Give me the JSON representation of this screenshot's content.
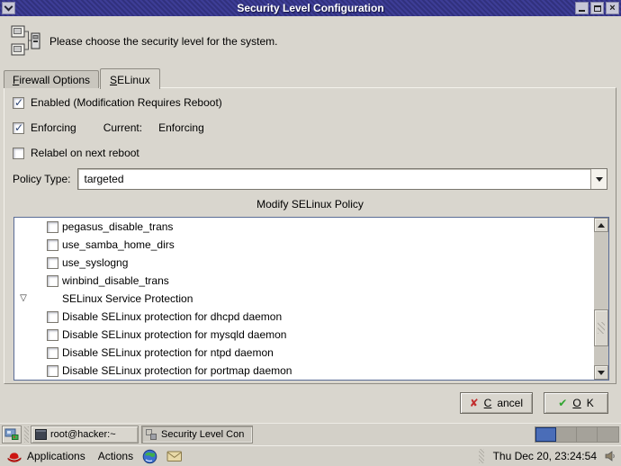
{
  "window": {
    "title": "Security Level Configuration",
    "header": {
      "text": "Please choose the security level for the system."
    },
    "tabs": [
      {
        "label": "Firewall Options",
        "mnemonic_index": 0,
        "active": false
      },
      {
        "label": "SELinux",
        "mnemonic_index": 0,
        "active": true
      }
    ],
    "selinux": {
      "options": [
        {
          "label": "Enabled (Modification Requires Reboot)",
          "checked": true
        },
        {
          "label": "Enforcing",
          "checked": true,
          "current_label": "Current:",
          "current_value": "Enforcing"
        },
        {
          "label": "Relabel on next reboot",
          "checked": false
        }
      ],
      "policy_type": {
        "label": "Policy Type:",
        "value": "targeted"
      },
      "policy_editor": {
        "title": "Modify SELinux Policy",
        "items": [
          {
            "type": "check",
            "label": "pegasus_disable_trans",
            "checked": false
          },
          {
            "type": "check",
            "label": "use_samba_home_dirs",
            "checked": false
          },
          {
            "type": "check",
            "label": "use_syslogng",
            "checked": false
          },
          {
            "type": "check",
            "label": "winbind_disable_trans",
            "checked": false
          },
          {
            "type": "group",
            "label": "SELinux Service Protection",
            "expanded": true
          },
          {
            "type": "check",
            "label": "Disable SELinux protection for dhcpd daemon",
            "checked": false
          },
          {
            "type": "check",
            "label": "Disable SELinux protection for mysqld daemon",
            "checked": false
          },
          {
            "type": "check",
            "label": "Disable SELinux protection for ntpd daemon",
            "checked": false
          },
          {
            "type": "check",
            "label": "Disable SELinux protection for portmap daemon",
            "checked": false
          }
        ]
      }
    },
    "actions": [
      {
        "label": "Cancel",
        "mnemonic_index": 0,
        "icon": "cancel-x-icon",
        "icon_glyph": "✘",
        "icon_color": "#c22f2f"
      },
      {
        "label": "OK",
        "mnemonic_index": 0,
        "icon": "ok-check-icon",
        "icon_glyph": "✔",
        "icon_color": "#2fa52f"
      }
    ]
  },
  "taskbar": {
    "tasks": [
      {
        "label": "root@hacker:~",
        "icon": "terminal-icon",
        "active": false
      },
      {
        "label": "Security Level Con",
        "icon": "security-window-icon",
        "active": true
      }
    ],
    "workspaces": {
      "count": 4,
      "active_index": 0
    }
  },
  "panel": {
    "menus": [
      {
        "label": "Applications",
        "icon": "redhat-menu-icon"
      },
      {
        "label": "Actions"
      }
    ],
    "launchers": [
      "web-browser-icon",
      "email-icon"
    ],
    "clock": "Thu Dec 20, 23:24:54",
    "volume_icon": "speaker-icon"
  },
  "icons": {
    "window-menu": "chevron-down",
    "minimize-icon": "thin dash",
    "maximize-icon": "window outline",
    "close-icon": "x",
    "network-security-icon": "two computers wired to a device",
    "tree-expander-icon": "open down triangle",
    "scroll-up-icon": "up triangle",
    "scroll-down-icon": "down triangle",
    "show-desktop-icon": "mini desktop",
    "redhat-menu-icon": "red fedora hat",
    "web-browser-icon": "blue-green globe",
    "email-icon": "beige envelope",
    "speaker-icon": "speaker"
  },
  "colors": {
    "titlebar_blue_dark": "#31317e",
    "titlebar_blue_light": "#3d3d96",
    "dialog_bg": "#d9d6ce",
    "list_focus_border": "#5a6c96",
    "workspace_active": "#4a6db8"
  }
}
